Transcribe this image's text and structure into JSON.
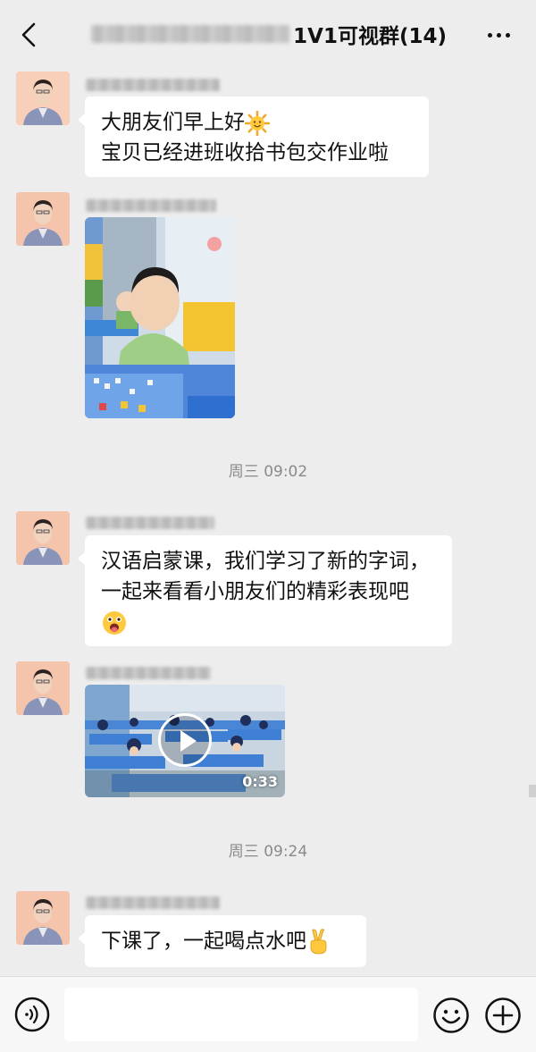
{
  "header": {
    "title": "1V1可视群(14)"
  },
  "messages": [
    {
      "type": "text",
      "lines": [
        "大朋友们早上好",
        "宝贝已经进班收拾书包交作业啦"
      ],
      "emoji": "sun-face-emoji"
    },
    {
      "type": "image",
      "icon": "classroom-photo"
    },
    {
      "type": "time",
      "text": "周三 09:02"
    },
    {
      "type": "text",
      "lines": [
        "汉语启蒙课，我们学习了新的字词，",
        "一起来看看小朋友们的精彩表现吧"
      ],
      "emoji": "tongue-face-emoji"
    },
    {
      "type": "video",
      "duration": "0:33"
    },
    {
      "type": "time",
      "text": "周三 09:24"
    },
    {
      "type": "text",
      "lines": [
        "下课了，一起喝点水吧"
      ],
      "emoji": "victory-hand-emoji"
    }
  ],
  "input": {
    "value": "",
    "placeholder": ""
  },
  "colors": {
    "background": "#ededed",
    "bubble": "#ffffff",
    "time_text": "#8a8a8a"
  }
}
